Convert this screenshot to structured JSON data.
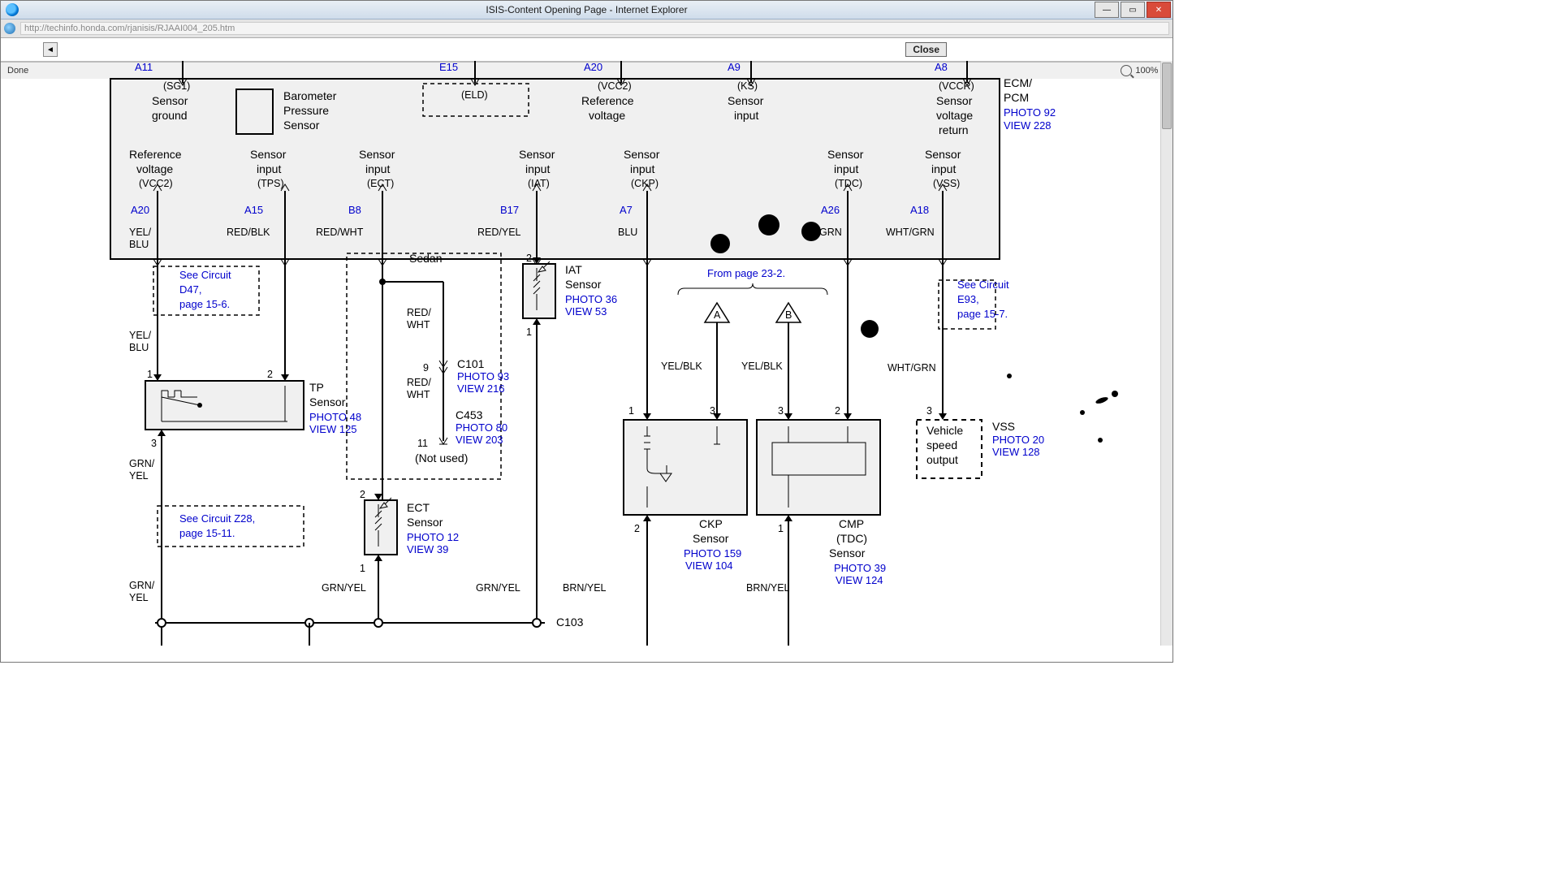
{
  "window": {
    "title": "ISIS-Content Opening Page - Internet Explorer",
    "url": "http://techinfo.honda.com/rjanisis/RJAAI004_205.htm"
  },
  "buttons": {
    "close": "Close",
    "nav_back": "◄"
  },
  "status": {
    "done": "Done",
    "zoom": "100%",
    "dropdown": "▾"
  },
  "ecm": {
    "title_l1": "ECM/",
    "title_l2": "PCM",
    "photo": "PHOTO 92",
    "view": "VIEW 228",
    "top_pins": {
      "a11": "A11",
      "e15": "E15",
      "a20": "A20",
      "a9": "A9",
      "a8": "A8"
    },
    "top_labels": {
      "sg1_code": "(SG1)",
      "sg1_l1": "Sensor",
      "sg1_l2": "ground",
      "baro_l1": "Barometer",
      "baro_l2": "Pressure",
      "baro_l3": "Sensor",
      "eld": "(ELD)",
      "vcc2_code": "(VCC2)",
      "vcc2_l1": "Reference",
      "vcc2_l2": "voltage",
      "ks_code": "(KS)",
      "ks_l1": "Sensor",
      "ks_l2": "input",
      "vccr_code": "(VCCR)",
      "vccr_l1": "Sensor",
      "vccr_l2": "voltage",
      "vccr_l3": "return"
    },
    "bot_labels": {
      "ref_l1": "Reference",
      "ref_l2": "voltage",
      "ref_code": "(VCC2)",
      "tps_l1": "Sensor",
      "tps_l2": "input",
      "tps_code": "(TPS)",
      "ect_l1": "Sensor",
      "ect_l2": "input",
      "ect_code": "(ECT)",
      "iat_l1": "Sensor",
      "iat_l2": "input",
      "iat_code": "(IAT)",
      "ckp_l1": "Sensor",
      "ckp_l2": "input",
      "ckp_code": "(CKP)",
      "tdc_l1": "Sensor",
      "tdc_l2": "input",
      "tdc_code": "(TDC)",
      "vss_l1": "Sensor",
      "vss_l2": "input",
      "vss_code": "(VSS)"
    },
    "bot_pins": {
      "a20": "A20",
      "a15": "A15",
      "b8": "B8",
      "b17": "B17",
      "a7": "A7",
      "a26": "A26",
      "a18": "A18"
    }
  },
  "wires": {
    "yelblu1": "YEL/",
    "yelblu2": "BLU",
    "redblk": "RED/BLK",
    "redwht": "RED/WHT",
    "redyel": "RED/YEL",
    "blu": "BLU",
    "grn": "GRN",
    "whtgrn": "WHT/GRN",
    "grnyel1": "GRN/",
    "grnyel2": "YEL",
    "grnyel": "GRN/YEL",
    "redwht1": "RED/",
    "redwht2": "WHT",
    "yelblk": "YEL/BLK",
    "brnyel": "BRN/YEL",
    "c103": "C103"
  },
  "refs": {
    "d47_l1": "See Circuit",
    "d47_l2": "D47,",
    "d47_l3": "page 15-6.",
    "z28_l1": "See Circuit Z28,",
    "z28_l2": "page 15-11.",
    "e93_l1": "See Circuit",
    "e93_l2": "E93,",
    "e93_l3": "page 15-7.",
    "from_page": "From page 23-2.",
    "sedan": "Sedan",
    "not_used": "(Not used)",
    "c101": "C101",
    "c101_photo": "PHOTO 93",
    "c101_view": "VIEW 216",
    "c453": "C453",
    "c453_photo": "PHOTO 80",
    "c453_view": "VIEW 203"
  },
  "sensors": {
    "tp_l1": "TP",
    "tp_l2": "Sensor",
    "tp_photo": "PHOTO 48",
    "tp_view": "VIEW 125",
    "iat_l1": "IAT",
    "iat_l2": "Sensor",
    "iat_photo": "PHOTO 36",
    "iat_view": "VIEW 53",
    "ect_l1": "ECT",
    "ect_l2": "Sensor",
    "ect_photo": "PHOTO 12",
    "ect_view": "VIEW 39",
    "ckp_l1": "CKP",
    "ckp_l2": "Sensor",
    "ckp_photo": "PHOTO 159",
    "ckp_view": "VIEW 104",
    "cmp_l1": "CMP",
    "cmp_l2": "(TDC)",
    "cmp_l3": "Sensor",
    "cmp_photo": "PHOTO 39",
    "cmp_view": "VIEW 124",
    "vss_l1": "VSS",
    "vss_photo": "PHOTO 20",
    "vss_view": "VIEW 128",
    "vss_box_l1": "Vehicle",
    "vss_box_l2": "speed",
    "vss_box_l3": "output"
  },
  "nums": {
    "n1": "1",
    "n2": "2",
    "n3": "3",
    "n9": "9",
    "n11": "11",
    "letA": "A",
    "letB": "B"
  }
}
